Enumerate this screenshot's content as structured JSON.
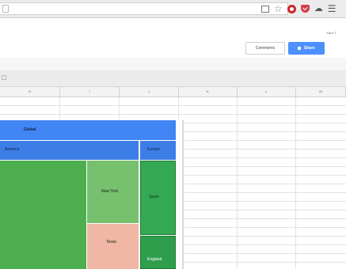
{
  "browser": {
    "icons": [
      "reader-view-icon",
      "bookmark-star-icon",
      "ublock-icon",
      "pocket-icon",
      "sync-cloud-icon",
      "hamburger-menu-icon"
    ]
  },
  "header": {
    "user_label": "Sara T.",
    "comments_label": "Comments",
    "share_label": "Share"
  },
  "columns": [
    "H",
    "I",
    "J",
    "K",
    "L",
    "M"
  ],
  "chart_data": {
    "type": "treemap",
    "nodes": [
      {
        "label": "Global",
        "level": 0
      },
      {
        "label": "America",
        "level": 1
      },
      {
        "label": "Europe",
        "level": 1
      },
      {
        "label": "",
        "level": 2
      },
      {
        "label": "New York",
        "level": 2
      },
      {
        "label": "Texas",
        "level": 2
      },
      {
        "label": "Spain",
        "level": 2
      },
      {
        "label": "England",
        "level": 2
      }
    ],
    "colors": {
      "header": "#4285f4",
      "usa": "#4cae4c",
      "new_york": "#76c06e",
      "texas": "#f0b7a4",
      "spain": "#34a853",
      "england": "#2f9e4c"
    }
  },
  "colors": {
    "share_button": "#4d90fe",
    "adblock_icon": "#c9262d",
    "pocket_icon": "#d3404d"
  }
}
